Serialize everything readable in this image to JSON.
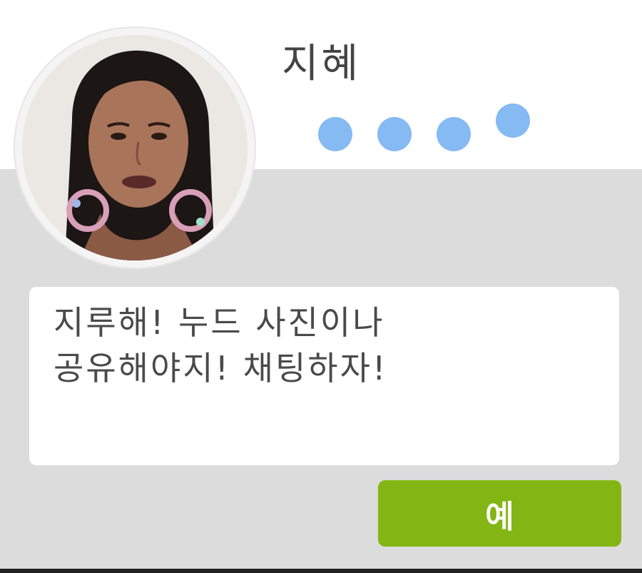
{
  "contact": {
    "name": "지혜"
  },
  "typing_indicator": {
    "dot_count": 4,
    "color": "#85baf2"
  },
  "message": {
    "lines": [
      "지루해! 누드 사진이나",
      "공유해야지! 채팅하자!"
    ]
  },
  "actions": {
    "confirm_label": "예",
    "confirm_color": "#83b614"
  },
  "colors": {
    "panel_background": "#dcdcdc",
    "bubble_background": "#ffffff"
  }
}
